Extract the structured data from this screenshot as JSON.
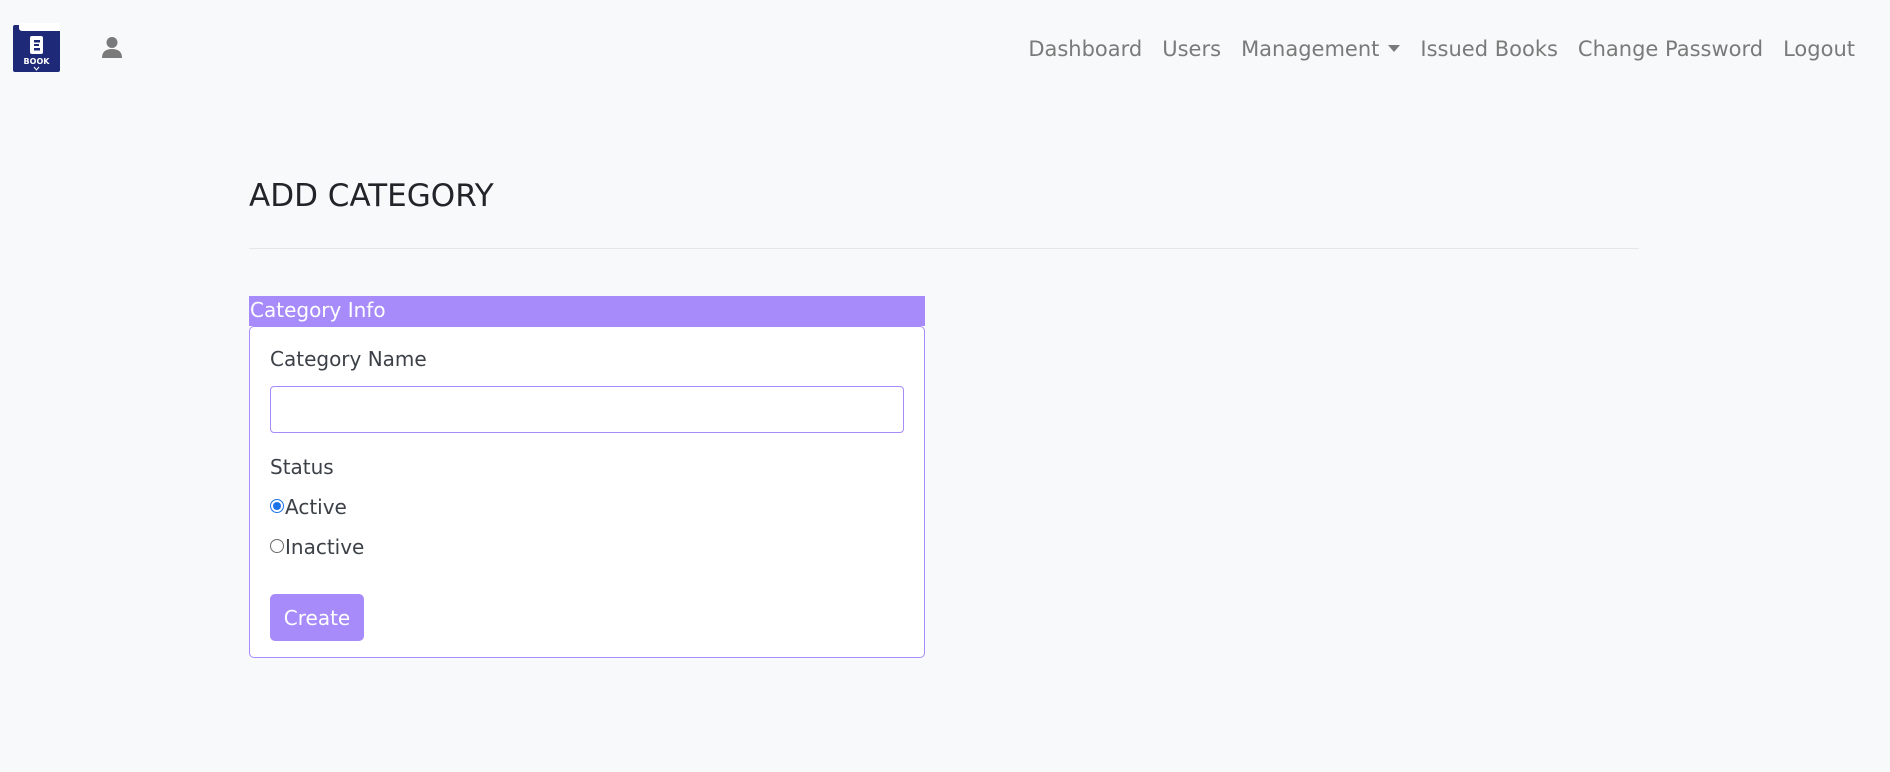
{
  "logo": {
    "letter": "E",
    "text": "BOOK"
  },
  "nav": {
    "items": [
      {
        "label": "Dashboard"
      },
      {
        "label": "Users"
      },
      {
        "label": "Management"
      },
      {
        "label": "Issued Books"
      },
      {
        "label": "Change Password"
      },
      {
        "label": "Logout"
      }
    ]
  },
  "page": {
    "title": "ADD CATEGORY"
  },
  "form": {
    "header": "Category Info",
    "category_name_label": "Category Name",
    "category_name_value": "",
    "status_label": "Status",
    "status_options": [
      {
        "label": "Active",
        "checked": true
      },
      {
        "label": "Inactive",
        "checked": false
      }
    ],
    "submit_label": "Create"
  },
  "colors": {
    "accent": "#a78bfa",
    "logo_bg": "#1e2a78",
    "radio_checked": "#1a73e8",
    "page_bg": "#f8f9fa"
  },
  "icons": {
    "user": "user-icon",
    "dropdown": "caret-down-icon",
    "logo": "ebook-logo-icon"
  }
}
